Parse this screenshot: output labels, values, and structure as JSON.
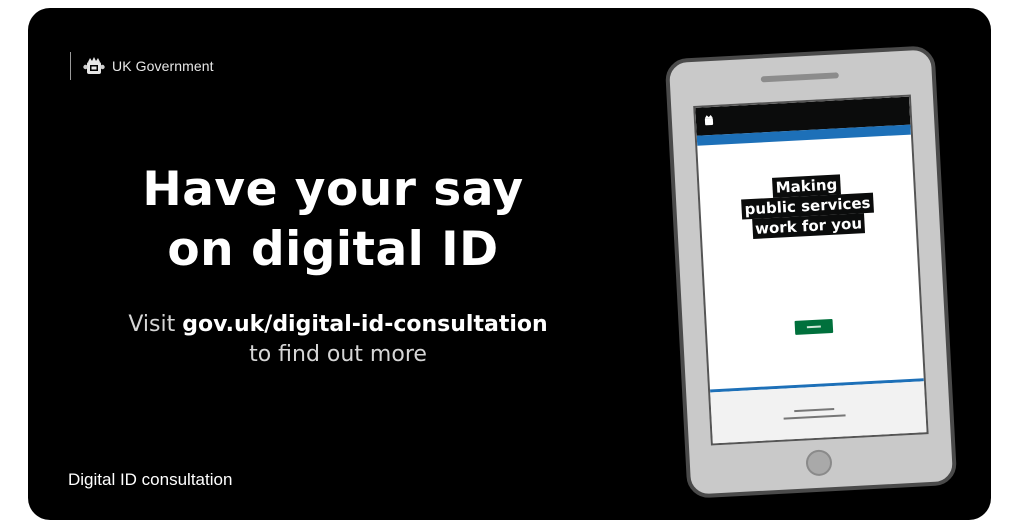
{
  "card": {
    "brand": {
      "name": "UK Government",
      "crest_icon": "royal-crest-icon"
    },
    "headline": {
      "line1": "Have your say",
      "line2": "on digital ID"
    },
    "subline": {
      "prefix": "Visit",
      "url": "gov.uk/digital-id-consultation",
      "suffix": "to find out more"
    },
    "caption": "Digital ID consultation",
    "phone": {
      "screen_lines": [
        "Making",
        "public services",
        "work for you"
      ]
    },
    "colors": {
      "background": "#000000",
      "govuk_blue": "#1d70b8",
      "govuk_green": "#00703c"
    }
  }
}
